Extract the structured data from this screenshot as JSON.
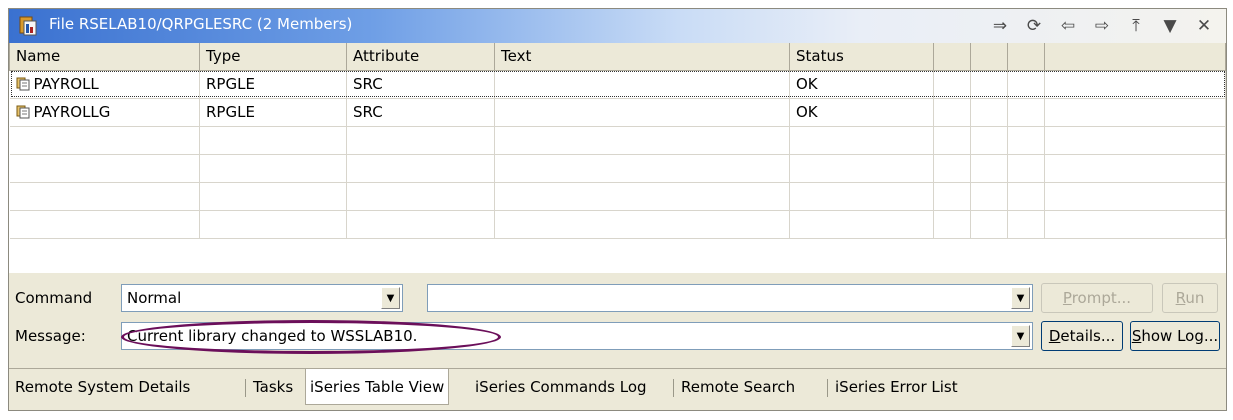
{
  "window": {
    "title": "File RSELAB10/QRPGLESRC (2 Members)",
    "toolbar_icons": [
      "link-with-editor-icon",
      "refresh-icon",
      "back-icon",
      "forward-icon",
      "up-level-icon",
      "view-menu-icon",
      "close-icon"
    ],
    "toolbar_glyphs": [
      "⇒",
      "⟳",
      "⇦",
      "⇨",
      "⤒",
      "▼",
      "✕"
    ]
  },
  "table": {
    "columns": [
      "Name",
      "Type",
      "Attribute",
      "Text",
      "Status",
      "",
      "",
      ""
    ],
    "rows": [
      {
        "name": "PAYROLL",
        "type": "RPGLE",
        "attribute": "SRC",
        "text": "",
        "status": "OK"
      },
      {
        "name": "PAYROLLG",
        "type": "RPGLE",
        "attribute": "SRC",
        "text": "",
        "status": "OK"
      }
    ]
  },
  "command": {
    "label": "Command",
    "mode_value": "Normal",
    "command_value": "",
    "prompt_label": "Prompt...",
    "run_label": "Run"
  },
  "message": {
    "label": "Message:",
    "value": "Current library changed to WSSLAB10.",
    "details_label": "Details...",
    "show_log_label": "Show Log..."
  },
  "tabs": [
    "Remote System Details",
    "Tasks",
    "iSeries Table View",
    "iSeries Commands Log",
    "Remote Search",
    "iSeries Error List"
  ],
  "active_tab": "iSeries Table View",
  "colors": {
    "title_start": "#3a71d0",
    "annotation_ellipse": "#6b0f5a",
    "panel": "#ece9d8"
  }
}
